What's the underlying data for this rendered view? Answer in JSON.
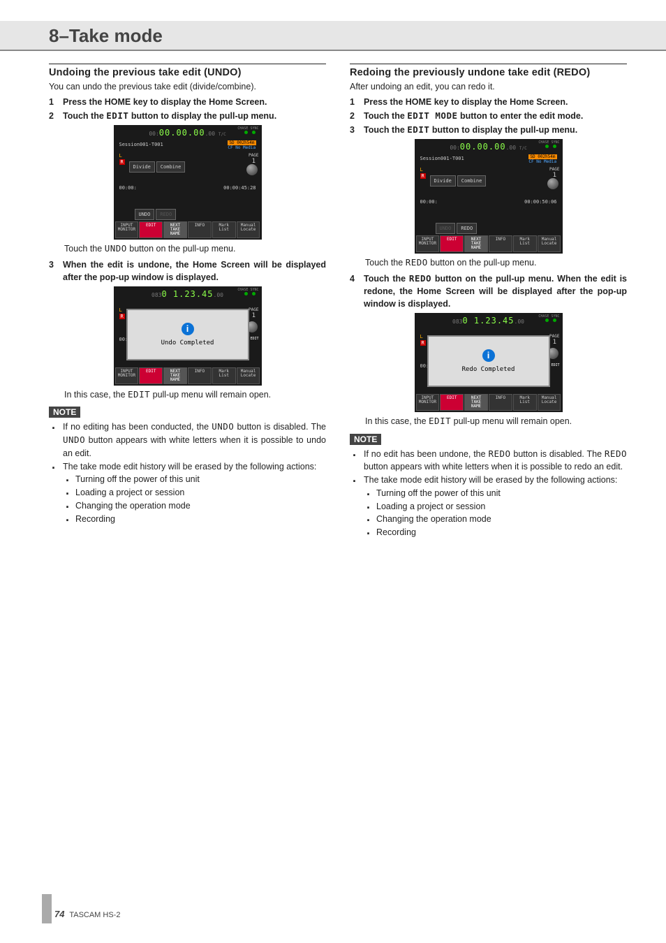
{
  "header": {
    "title": "8–Take mode"
  },
  "footer": {
    "page": "74",
    "model": "TASCAM HS-2"
  },
  "undo": {
    "heading": "Undoing the previous take edit (UNDO)",
    "intro": "You can undo the previous take edit (divide/combine).",
    "steps": {
      "s1_num": "1",
      "s1_txt": "Press the HOME key to display the Home Screen.",
      "s2_num": "2",
      "s2_pre": "Touch the ",
      "s2_mono": "EDIT",
      "s2_post": " button to display the pull-up menu.",
      "s2_cap_pre": "Touch the ",
      "s2_cap_mono": "UNDO",
      "s2_cap_post": " button on the pull-up menu.",
      "s3_num": "3",
      "s3_txt": "When the edit is undone, the Home Screen will be displayed after the pop-up window is displayed.",
      "s3_cap_pre": "In this case, the ",
      "s3_cap_mono": "EDIT",
      "s3_cap_post": " pull-up menu will remain open."
    },
    "note_label": "NOTE",
    "note_b1a": "If no editing has been conducted, the ",
    "note_b1b": "UNDO",
    "note_b1c": " button is disabled. The ",
    "note_b1d": "UNDO",
    "note_b1e": " button appears with white letters when it is possible to undo an edit.",
    "note_b2": "The take mode edit history will be erased by the following actions:",
    "actions": {
      "a1": "Turning off the power of this unit",
      "a2": "Loading a project or session",
      "a3": "Changing the operation mode",
      "a4": "Recording"
    }
  },
  "redo": {
    "heading": "Redoing the previously undone take edit (REDO)",
    "intro": "After undoing an edit, you can redo it.",
    "steps": {
      "s1_num": "1",
      "s1_txt": "Press the HOME key to display the Home Screen.",
      "s2_num": "2",
      "s2_pre": "Touch the ",
      "s2_mono": "EDIT MODE",
      "s2_post": " button to enter the edit mode.",
      "s3_num": "3",
      "s3_pre": "Touch the ",
      "s3_mono": "EDIT",
      "s3_post": " button to display the pull-up menu.",
      "s3_cap_pre": "Touch the ",
      "s3_cap_mono": "REDO",
      "s3_cap_post": " button on the pull-up menu.",
      "s4_num": "4",
      "s4_pre": "Touch the ",
      "s4_mono": "REDO",
      "s4_post": " button on the pull-up menu. When the edit is redone, the Home Screen will be displayed after the pop-up window is displayed.",
      "s4_cap_pre": "In this case, the ",
      "s4_cap_mono": "EDIT",
      "s4_cap_post": " pull-up menu will remain open."
    },
    "note_label": "NOTE",
    "note_b1a": "If no edit has been undone, the ",
    "note_b1b": "REDO",
    "note_b1c": " button is disabled. The ",
    "note_b1d": "REDO",
    "note_b1e": " button appears with white letters when it is possible to redo an edit.",
    "note_b2": "The take mode edit history will be erased by the following actions:",
    "actions": {
      "a1": "Turning off the power of this unit",
      "a2": "Loading a project or session",
      "a3": "Changing the operation mode",
      "a4": "Recording"
    }
  },
  "screens": {
    "a": {
      "zeros": "00:",
      "hms": "00.00.00",
      "frames": ".00",
      "tc_lab": "T/C",
      "session": "Session001-T001",
      "sd": "SD  002h54m",
      "cf": "CF  No Media",
      "L": "L",
      "R": "R",
      "divide": "Divide",
      "combine": "Combine",
      "page": "PAGE",
      "page_n": "1",
      "zero_l": "00:00:",
      "time_r": "00:00:45:28",
      "undo": "UNDO",
      "redo": "REDO",
      "b1": "INPUT\nMONITOR",
      "b_edit": "EDIT",
      "b3": "NEXT\nTAKE\nNAME",
      "b4": "INFO",
      "b5": "Mark\nList",
      "b6": "Manual\nLocate",
      "chase": "CHASE",
      "sync": "SYNC"
    },
    "b": {
      "zeros": "083",
      "hms": "0 1.23.45",
      "frames": ".00",
      "L": "L",
      "R": "R",
      "page": "PAGE",
      "page_n": "1",
      "dialog": "Undo Completed",
      "zero_l": "00:",
      "edit_ind": "EDIT",
      "b1": "INPUT\nMONITOR",
      "b_edit": "EDIT",
      "b3": "NEXT\nTAKE\nNAME",
      "b4": "INFO",
      "b5": "Mark\nList",
      "b6": "Manual\nLocate",
      "chase": "CHASE",
      "sync": "SYNC"
    },
    "c": {
      "zeros": "00:",
      "hms": "00.00.00",
      "frames": ".00",
      "tc_lab": "T/C",
      "session": "Session001-T001",
      "sd": "SD  002h54m",
      "cf": "CF  No Media",
      "L": "L",
      "R": "R",
      "divide": "Divide",
      "combine": "Combine",
      "page": "PAGE",
      "page_n": "1",
      "zero_l": "00:00:",
      "time_r": "00:00:50:06",
      "undo": "UNDO",
      "redo": "REDO",
      "b1": "INPUT\nMONITOR",
      "b_edit": "EDIT",
      "b3": "NEXT\nTAKE\nNAME",
      "b4": "INFO",
      "b5": "Mark\nList",
      "b6": "Manual\nLocate",
      "chase": "CHASE",
      "sync": "SYNC"
    },
    "d": {
      "zeros": "083",
      "hms": "0 1.23.45",
      "frames": ".00",
      "L": "L",
      "R": "R",
      "page": "PAGE",
      "page_n": "1",
      "dialog": "Redo Completed",
      "zero_l": "00:",
      "edit_ind": "EDIT",
      "b1": "INPUT\nMONITOR",
      "b_edit": "EDIT",
      "b3": "NEXT\nTAKE\nNAME",
      "b4": "INFO",
      "b5": "Mark\nList",
      "b6": "Manual\nLocate",
      "chase": "CHASE",
      "sync": "SYNC"
    }
  }
}
